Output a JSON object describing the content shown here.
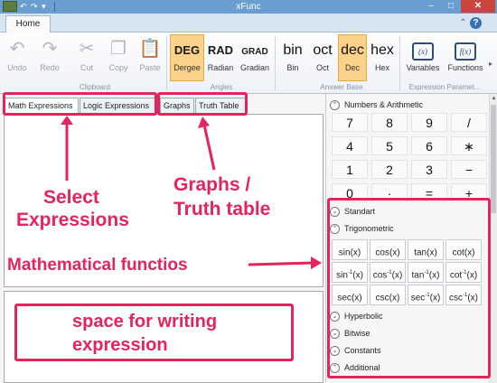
{
  "window": {
    "title": "xFunc",
    "qa_glyphs": "↶ ↷ ▾",
    "minimize": "–",
    "maximize": "□",
    "close": "✕"
  },
  "ribbon_tabs": {
    "home": "Home",
    "expand_glyph": "⌃",
    "help_glyph": "?"
  },
  "ribbon": {
    "undo": {
      "icon": "↶",
      "label": "Undo"
    },
    "redo": {
      "icon": "↷",
      "label": "Redo"
    },
    "cut": {
      "icon": "✂",
      "label": "Cut"
    },
    "copy": {
      "icon": "❐",
      "label": "Copy"
    },
    "paste": {
      "icon": "📋",
      "label": "Paste"
    },
    "clipboard_group": "Clipboard",
    "deg": {
      "text": "DEG",
      "label": "Dergee"
    },
    "rad": {
      "text": "RAD",
      "label": "Radian"
    },
    "grad": {
      "text": "GRAD",
      "label": "Gradian"
    },
    "angles_group": "Angles",
    "bin": {
      "text": "bin",
      "label": "Bin"
    },
    "oct": {
      "text": "oct",
      "label": "Oct"
    },
    "dec": {
      "text": "dec",
      "label": "Dec"
    },
    "hex": {
      "text": "hex",
      "label": "Hex"
    },
    "answer_base_group": "Answer Base",
    "variables": {
      "icon": "(x)",
      "label": "Variables"
    },
    "functions": {
      "icon": "f(x)",
      "label": "Functions"
    },
    "expression_group": "Expression Paramet...",
    "more_arrow": "▸",
    "selected_angle": "DEG",
    "selected_base": "dec"
  },
  "expression_tabs": [
    "Math Expressions",
    "Logic Expressions",
    "Graphs",
    "Truth Table"
  ],
  "active_tab": "Math Expressions",
  "panel": {
    "numbers_header": "Numbers & Arithmetic",
    "numpad": [
      "7",
      "8",
      "9",
      "/",
      "4",
      "5",
      "6",
      "∗",
      "1",
      "2",
      "3",
      "−",
      "0",
      "·",
      "=",
      "+"
    ],
    "standart": "Standart",
    "trigonometric": "Trigonometric",
    "trig_functions": [
      {
        "name": "sin",
        "sup": "",
        "arg": "(x)"
      },
      {
        "name": "cos",
        "sup": "",
        "arg": "(x)"
      },
      {
        "name": "tan",
        "sup": "",
        "arg": "(x)"
      },
      {
        "name": "cot",
        "sup": "",
        "arg": "(x)"
      },
      {
        "name": "sin",
        "sup": "-1",
        "arg": "(x)"
      },
      {
        "name": "cos",
        "sup": "-1",
        "arg": "(x)"
      },
      {
        "name": "tan",
        "sup": "-1",
        "arg": "(x)"
      },
      {
        "name": "cot",
        "sup": "-1",
        "arg": "(x)"
      },
      {
        "name": "sec",
        "sup": "",
        "arg": "(x)"
      },
      {
        "name": "csc",
        "sup": "",
        "arg": "(x)"
      },
      {
        "name": "sec",
        "sup": "-1",
        "arg": "(x)"
      },
      {
        "name": "csc",
        "sup": "-1",
        "arg": "(x)"
      }
    ],
    "hyperbolic": "Hyperbolic",
    "bitwise": "Bitwise",
    "constants": "Constants",
    "additional": "Additional",
    "collapse_glyph": "⌃",
    "expand_glyph": "⌄"
  },
  "annotations": {
    "select_expressions": [
      "Select",
      "Expressions"
    ],
    "graphs_truth": [
      "Graphs  /",
      "Truth table"
    ],
    "mathematical_functions": "Mathematical functios",
    "space_for_writing": [
      "space for writing",
      "expression"
    ],
    "color": "#e5245e"
  }
}
